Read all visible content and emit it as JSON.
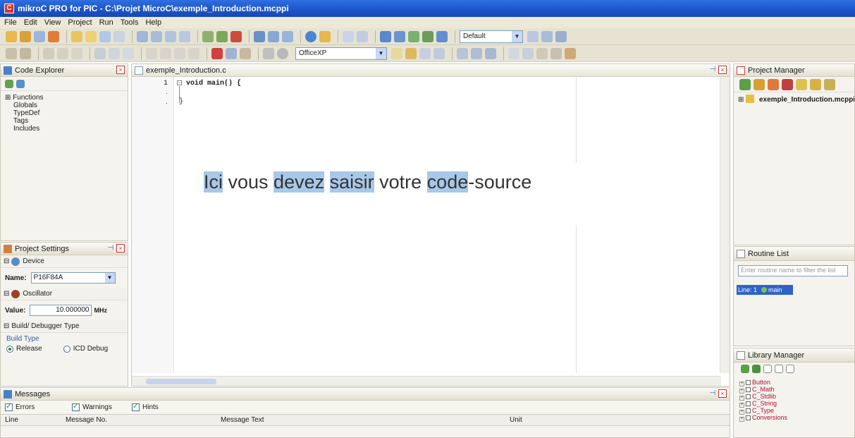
{
  "window": {
    "title": "mikroC PRO for PIC - C:\\Projet MicroC\\exemple_Introduction.mcppi"
  },
  "menu": [
    "File",
    "Edit",
    "View",
    "Project",
    "Run",
    "Tools",
    "Help"
  ],
  "toolbar": {
    "config_combo": "Default",
    "theme_combo": "OfficeXP"
  },
  "code_explorer": {
    "title": "Code Explorer",
    "tree": [
      "Functions",
      "Globals",
      "TypeDef",
      "Tags",
      "Includes"
    ]
  },
  "project_settings": {
    "title": "Project Settings",
    "device_section": "Device",
    "name_label": "Name:",
    "name_value": "P16F84A",
    "oscillator_section": "Oscillator",
    "value_label": "Value:",
    "value_value": "10.000000",
    "value_unit": "MHz",
    "build_section": "Build/ Debugger Type",
    "build_type_label": "Build Type",
    "release_label": "Release",
    "icd_label": "ICD Debug"
  },
  "editor": {
    "tab_title": "exemple_Introduction.c",
    "line_number": "1",
    "code_line": "void main() {",
    "code_close": "}",
    "overlay": {
      "w1": "Ici",
      "w2": " vous ",
      "w3": "devez",
      "w4": " ",
      "w5": "saisir",
      "w6": " votre ",
      "w7": "code",
      "w8": "-source"
    }
  },
  "messages": {
    "title": "Messages",
    "checks": {
      "errors": "Errors",
      "warnings": "Warnings",
      "hints": "Hints"
    },
    "columns": {
      "line": "Line",
      "msg_no": "Message No.",
      "msg_text": "Message Text",
      "unit": "Unit"
    }
  },
  "project_manager": {
    "title": "Project Manager",
    "project_node": "exemple_Introduction.mcppi"
  },
  "routine_list": {
    "title": "Routine List",
    "filter_placeholder": "Enter routine name to filter the list",
    "line_label": "Line: 1",
    "routine": "main"
  },
  "library_manager": {
    "title": "Library Manager",
    "items": [
      "Button",
      "C_Math",
      "C_Stdlib",
      "C_String",
      "C_Type",
      "Conversions"
    ]
  },
  "colors": {
    "title_bar": "#1a54c8",
    "highlight": "#a8c8e8",
    "library_text": "#b0102e"
  }
}
